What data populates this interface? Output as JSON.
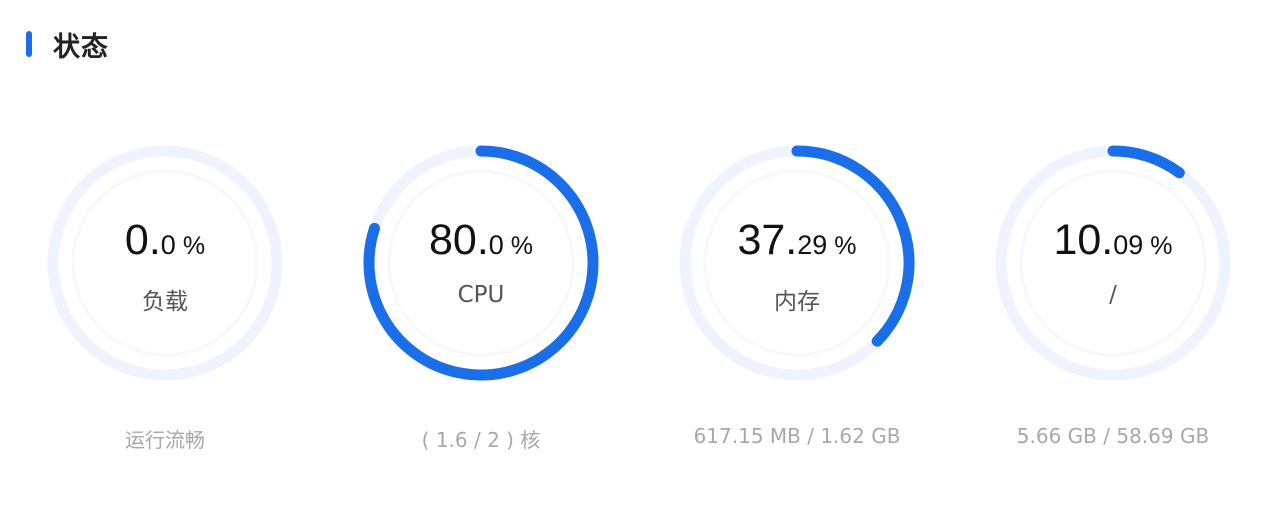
{
  "header": {
    "title": "状态"
  },
  "colors": {
    "accent": "#1a6fe8",
    "track": "#eef3fd",
    "inner_ring": "#f6f8fe",
    "detail_text": "#a8a8a8"
  },
  "gauges": [
    {
      "value_int": "0",
      "value_dec": "0",
      "unit": "%",
      "percent": 0.0,
      "label": "负载",
      "detail": "运行流畅"
    },
    {
      "value_int": "80",
      "value_dec": "0",
      "unit": "%",
      "percent": 80.0,
      "label": "CPU",
      "detail": "( 1.6 / 2 ) 核"
    },
    {
      "value_int": "37",
      "value_dec": "29",
      "unit": "%",
      "percent": 37.29,
      "label": "内存",
      "detail": "617.15 MB / 1.62 GB"
    },
    {
      "value_int": "10",
      "value_dec": "09",
      "unit": "%",
      "percent": 10.09,
      "label": "/",
      "detail": "5.66 GB / 58.69 GB"
    }
  ]
}
